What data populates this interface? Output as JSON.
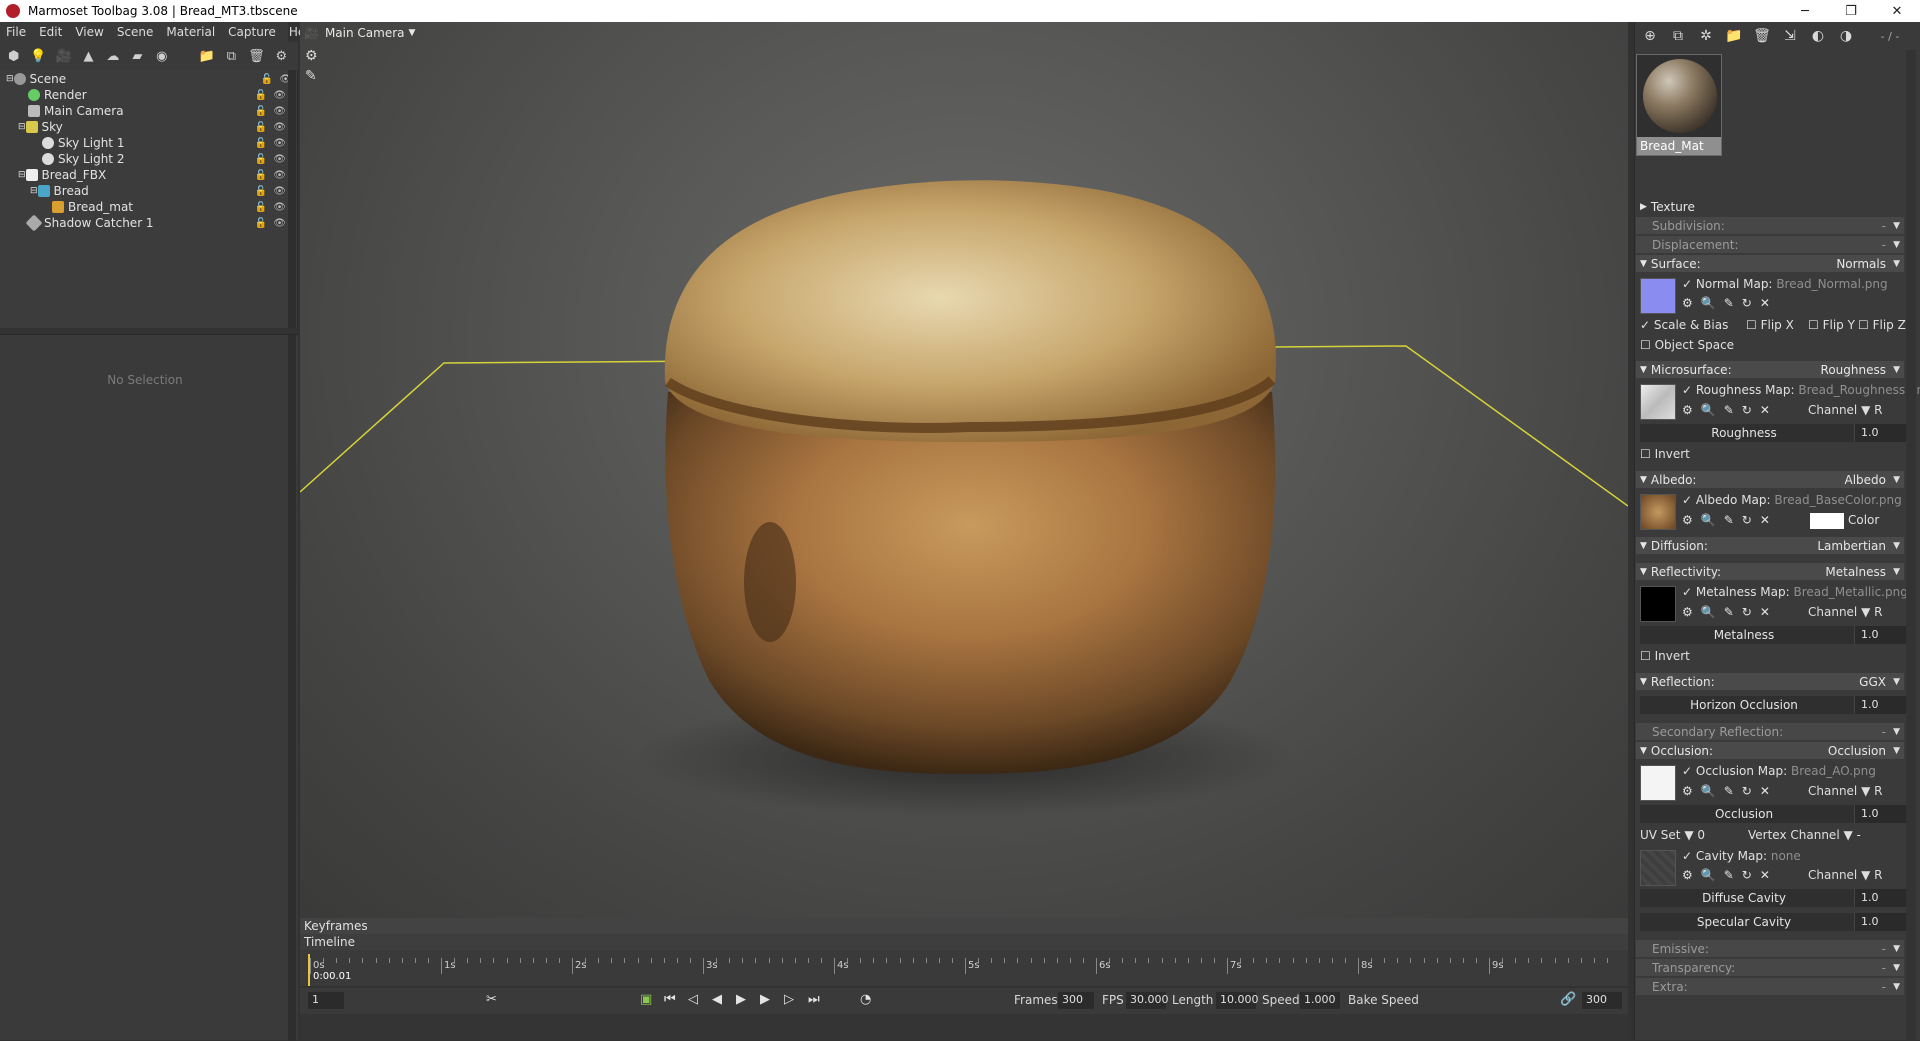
{
  "window": {
    "title": "Marmoset Toolbag 3.08  |  Bread_MT3.tbscene",
    "minimize": "─",
    "restore": "❐",
    "close": "✕"
  },
  "menu": [
    "File",
    "Edit",
    "View",
    "Scene",
    "Material",
    "Capture",
    "Help"
  ],
  "scene_tree": [
    {
      "label": "Scene",
      "icon": "scene-icon"
    },
    {
      "label": "Render",
      "icon": "render-icon"
    },
    {
      "label": "Main Camera",
      "icon": "camera-icon"
    },
    {
      "label": "Sky",
      "icon": "sky-icon"
    },
    {
      "label": "Sky Light 1",
      "icon": "light-icon"
    },
    {
      "label": "Sky Light 2",
      "icon": "light-icon"
    },
    {
      "label": "Bread_FBX",
      "icon": "fbx-icon"
    },
    {
      "label": "Bread",
      "icon": "mesh-icon"
    },
    {
      "label": "Bread_mat",
      "icon": "material-icon"
    },
    {
      "label": "Shadow Catcher 1",
      "icon": "shadow-catcher-icon"
    }
  ],
  "properties": {
    "no_selection": "No Selection"
  },
  "viewport": {
    "camera": "Main Camera"
  },
  "timeline": {
    "keyframes_label": "Keyframes",
    "timeline_label": "Timeline",
    "tick_labels": [
      "0s",
      "1s",
      "2s",
      "3s",
      "4s",
      "5s",
      "6s",
      "7s",
      "8s",
      "9s"
    ],
    "current_time": "0:00.01",
    "frame_field": "1",
    "frames_label": "Frames",
    "frames": "300",
    "fps_label": "FPS",
    "fps": "30.000",
    "length_label": "Length",
    "length": "10.000",
    "speed_label": "Speed",
    "speed": "1.000",
    "bake_speed": "Bake Speed",
    "end_frame": "300"
  },
  "material": {
    "name": "Bread_Mat",
    "top_right": "- / -",
    "texture": "Texture",
    "subdivision": {
      "label": "Subdivision:",
      "value": "-"
    },
    "displacement": {
      "label": "Displacement:",
      "value": "-"
    },
    "surface": {
      "label": "Surface:",
      "value": "Normals",
      "map_label": "Normal Map:",
      "map_file": "Bread_Normal.png",
      "scale_bias": "Scale & Bias",
      "flip_x": "Flip X",
      "flip_y": "Flip Y",
      "flip_z": "Flip Z",
      "object_space": "Object Space"
    },
    "microsurface": {
      "label": "Microsurface:",
      "value": "Roughness",
      "map_label": "Roughness Map:",
      "map_file": "Bread_Roughness.png",
      "channel": "Channel",
      "channel_val": "R",
      "slider": "Roughness",
      "slider_val": "1.0",
      "invert": "Invert"
    },
    "albedo": {
      "label": "Albedo:",
      "value": "Albedo",
      "map_label": "Albedo Map:",
      "map_file": "Bread_BaseColor.png",
      "color": "Color"
    },
    "diffusion": {
      "label": "Diffusion:",
      "value": "Lambertian"
    },
    "reflectivity": {
      "label": "Reflectivity:",
      "value": "Metalness",
      "map_label": "Metalness Map:",
      "map_file": "Bread_Metallic.png",
      "channel": "Channel",
      "channel_val": "R",
      "slider": "Metalness",
      "slider_val": "1.0",
      "invert": "Invert"
    },
    "reflection": {
      "label": "Reflection:",
      "value": "GGX",
      "slider": "Horizon Occlusion",
      "slider_val": "1.0"
    },
    "secondary_reflection": {
      "label": "Secondary Reflection:",
      "value": "-"
    },
    "occlusion": {
      "label": "Occlusion:",
      "value": "Occlusion",
      "map_label": "Occlusion Map:",
      "map_file": "Bread_AO.png",
      "channel": "Channel",
      "channel_val": "R",
      "slider": "Occlusion",
      "slider_val": "1.0",
      "uv_set": "UV Set",
      "uv_val": "0",
      "vertex_channel": "Vertex Channel",
      "vertex_val": "-",
      "cavity_label": "Cavity Map:",
      "cavity_file": "none",
      "cavity_channel": "Channel",
      "cavity_channel_val": "R",
      "diffuse_cavity": "Diffuse Cavity",
      "diffuse_cavity_val": "1.0",
      "specular_cavity": "Specular Cavity",
      "specular_cavity_val": "1.0"
    },
    "emissive": {
      "label": "Emissive:",
      "value": "-"
    },
    "transparency": {
      "label": "Transparency:",
      "value": "-"
    },
    "extra": {
      "label": "Extra:",
      "value": "-"
    }
  }
}
